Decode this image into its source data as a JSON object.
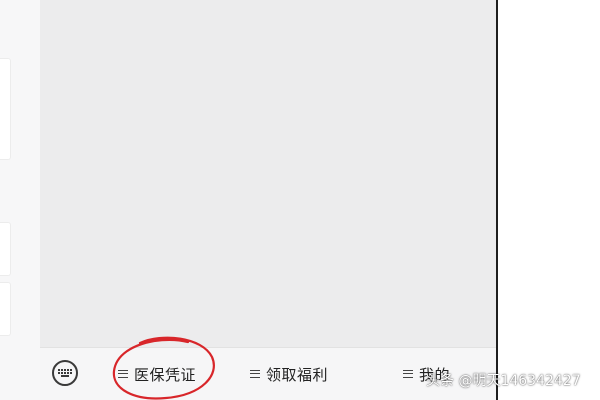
{
  "menu": {
    "keyboard_icon": "keyboard-icon",
    "items": [
      {
        "icon": "menu-lines-icon",
        "label": "医保凭证"
      },
      {
        "icon": "menu-lines-icon",
        "label": "领取福利"
      },
      {
        "icon": "menu-lines-icon",
        "label": "我的"
      }
    ]
  },
  "annotation": {
    "circled_item": "医保凭证",
    "color": "#d8262a"
  },
  "watermark": {
    "text": "头条 @明天146342427"
  },
  "colors": {
    "chat_background": "#ececed",
    "menu_background": "#f6f6f7",
    "text": "#222222"
  }
}
